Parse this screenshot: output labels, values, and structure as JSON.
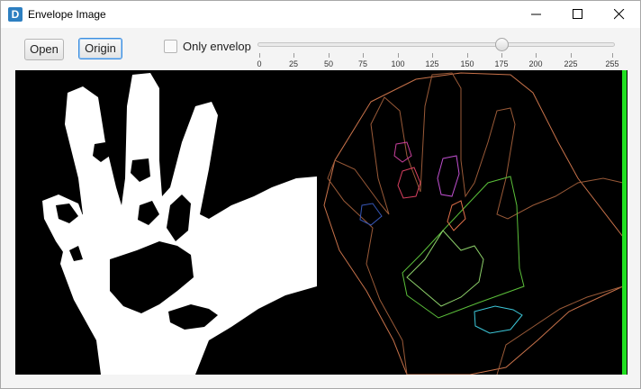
{
  "window": {
    "title": "Envelope Image",
    "app_icon_letter": "D"
  },
  "toolbar": {
    "open_label": "Open",
    "origin_label": "Origin",
    "only_envelop_label": "Only envelop",
    "only_envelop_checked": false
  },
  "slider": {
    "min": 0,
    "max": 255,
    "value": 175,
    "ticks": [
      "0",
      "25",
      "50",
      "75",
      "100",
      "125",
      "150",
      "175",
      "200",
      "225",
      "255"
    ]
  },
  "colors": {
    "left_divider": "#d9472b",
    "right_edge": "#20e020",
    "image_background": "#000000",
    "hand_fill": "#ffffff",
    "envelope_line": "#c8724a"
  }
}
